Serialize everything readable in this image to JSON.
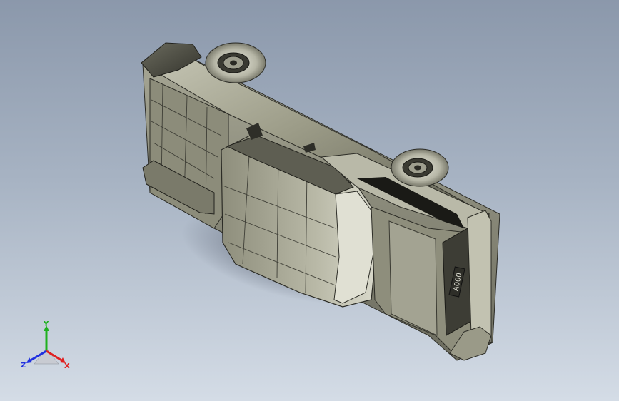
{
  "viewport": {
    "background_top": "#8b98ab",
    "background_bottom": "#d4dce6"
  },
  "model": {
    "plate_text": "A000",
    "body_color": "#9a9a86",
    "body_dark": "#55554a",
    "body_light": "#d6d6c8"
  },
  "triad": {
    "x_label": "X",
    "y_label": "Y",
    "z_label": "Z",
    "x_color": "#e02020",
    "y_color": "#1fb01f",
    "z_color": "#2030e0"
  }
}
